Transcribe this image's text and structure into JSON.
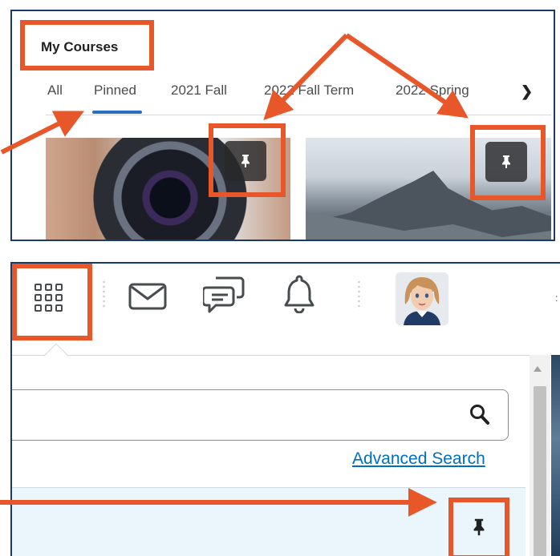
{
  "my_courses": {
    "title": "My Courses",
    "tabs": [
      "All",
      "Pinned",
      "2021 Fall",
      "2022 Fall Term",
      "2022 Spring"
    ],
    "active_tab": "Pinned",
    "next_icon": "chevron-right-icon",
    "cards": [
      {
        "image": "camera-lens-photo",
        "pin_icon": "pin-icon"
      },
      {
        "image": "mountain-photo",
        "pin_icon": "pin-icon"
      }
    ]
  },
  "navbar": {
    "icons": [
      "waffle-grid-icon",
      "envelope-icon",
      "chat-bubbles-icon",
      "bell-icon"
    ],
    "avatar": "user-avatar"
  },
  "course_search": {
    "search_icon": "search-icon",
    "advanced_search_label": "Advanced Search",
    "pinned_row_icon": "pin-icon"
  },
  "colors": {
    "highlight": "#e8572a",
    "arrow": "#e8572a",
    "active_tab_underline": "#2a6fba",
    "link": "#006fbf",
    "panel_border": "#1b3a6b",
    "pinned_row_bg": "#eaf5fc"
  }
}
